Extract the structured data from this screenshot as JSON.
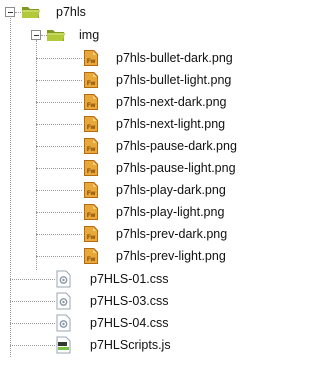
{
  "tree": {
    "root": {
      "label": "p7hls",
      "icon": "folder-open-icon",
      "expanded": true
    },
    "folder": {
      "label": "img",
      "icon": "folder-open-icon",
      "expanded": true
    },
    "images": [
      {
        "label": "p7hls-bullet-dark.png",
        "icon": "fireworks-png-icon"
      },
      {
        "label": "p7hls-bullet-light.png",
        "icon": "fireworks-png-icon"
      },
      {
        "label": "p7hls-next-dark.png",
        "icon": "fireworks-png-icon"
      },
      {
        "label": "p7hls-next-light.png",
        "icon": "fireworks-png-icon"
      },
      {
        "label": "p7hls-pause-dark.png",
        "icon": "fireworks-png-icon"
      },
      {
        "label": "p7hls-pause-light.png",
        "icon": "fireworks-png-icon"
      },
      {
        "label": "p7hls-play-dark.png",
        "icon": "fireworks-png-icon"
      },
      {
        "label": "p7hls-play-light.png",
        "icon": "fireworks-png-icon"
      },
      {
        "label": "p7hls-prev-dark.png",
        "icon": "fireworks-png-icon"
      },
      {
        "label": "p7hls-prev-light.png",
        "icon": "fireworks-png-icon"
      }
    ],
    "files": [
      {
        "label": "p7HLS-01.css",
        "icon": "css-file-icon"
      },
      {
        "label": "p7HLS-03.css",
        "icon": "css-file-icon"
      },
      {
        "label": "p7HLS-04.css",
        "icon": "css-file-icon"
      },
      {
        "label": "p7HLScripts.js",
        "icon": "js-file-icon"
      }
    ]
  },
  "colors": {
    "folder": "#b3c93c",
    "folder_dark": "#7f9a1f",
    "fireworks_icon": "#e8a93a",
    "fireworks_dark": "#b86a10",
    "tree_line": "#9a9a9a"
  }
}
